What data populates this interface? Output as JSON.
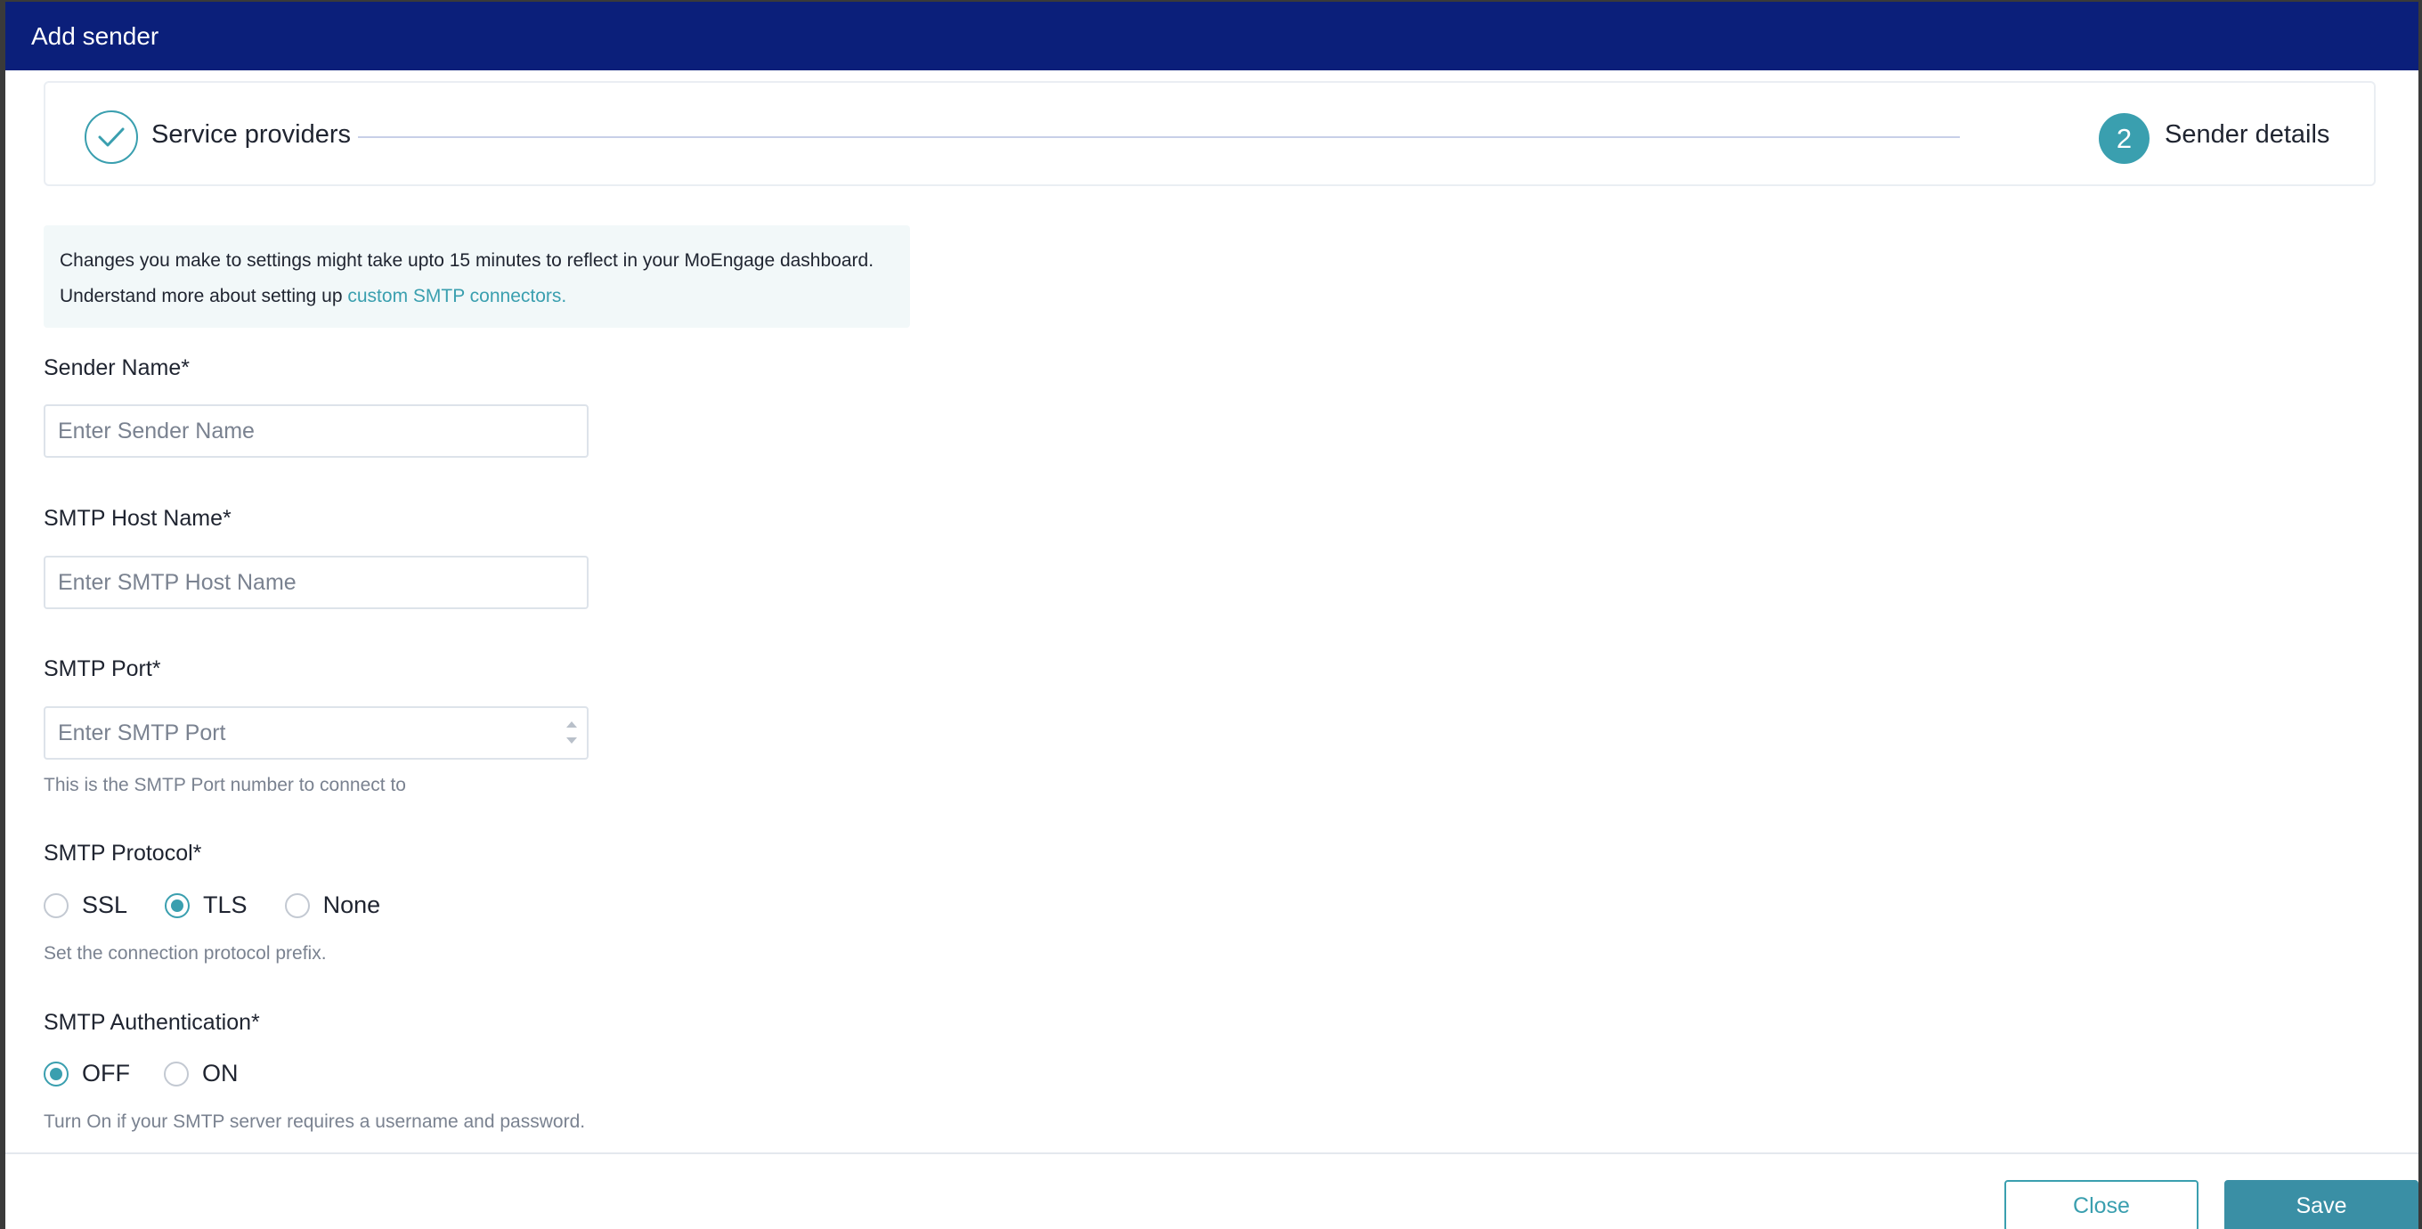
{
  "header": {
    "title": "Add sender"
  },
  "stepper": {
    "steps": [
      {
        "label": "Service providers",
        "state": "completed"
      },
      {
        "number": "2",
        "label": "Sender details",
        "state": "active"
      }
    ]
  },
  "info": {
    "line1": "Changes you make to settings might take upto 15 minutes to reflect in your MoEngage dashboard.",
    "line2_prefix": "Understand more about setting up ",
    "line2_link": "custom SMTP connectors."
  },
  "form": {
    "sender_name": {
      "label": "Sender Name*",
      "placeholder": "Enter Sender Name",
      "value": ""
    },
    "smtp_host": {
      "label": "SMTP Host Name*",
      "placeholder": "Enter SMTP Host Name",
      "value": ""
    },
    "smtp_port": {
      "label": "SMTP Port*",
      "placeholder": "Enter SMTP Port",
      "value": "",
      "hint": "This is the SMTP Port number to connect to"
    },
    "smtp_protocol": {
      "label": "SMTP Protocol*",
      "options": [
        "SSL",
        "TLS",
        "None"
      ],
      "selected": "TLS",
      "hint": "Set the connection protocol prefix."
    },
    "smtp_auth": {
      "label": "SMTP Authentication*",
      "options": [
        "OFF",
        "ON"
      ],
      "selected": "OFF",
      "hint": "Turn On if your SMTP server requires a username and password."
    }
  },
  "footer": {
    "close_label": "Close",
    "save_label": "Save"
  },
  "colors": {
    "header_bg": "#0b1f7a",
    "accent": "#3a9faf",
    "save_bg": "#3a8fa5"
  }
}
